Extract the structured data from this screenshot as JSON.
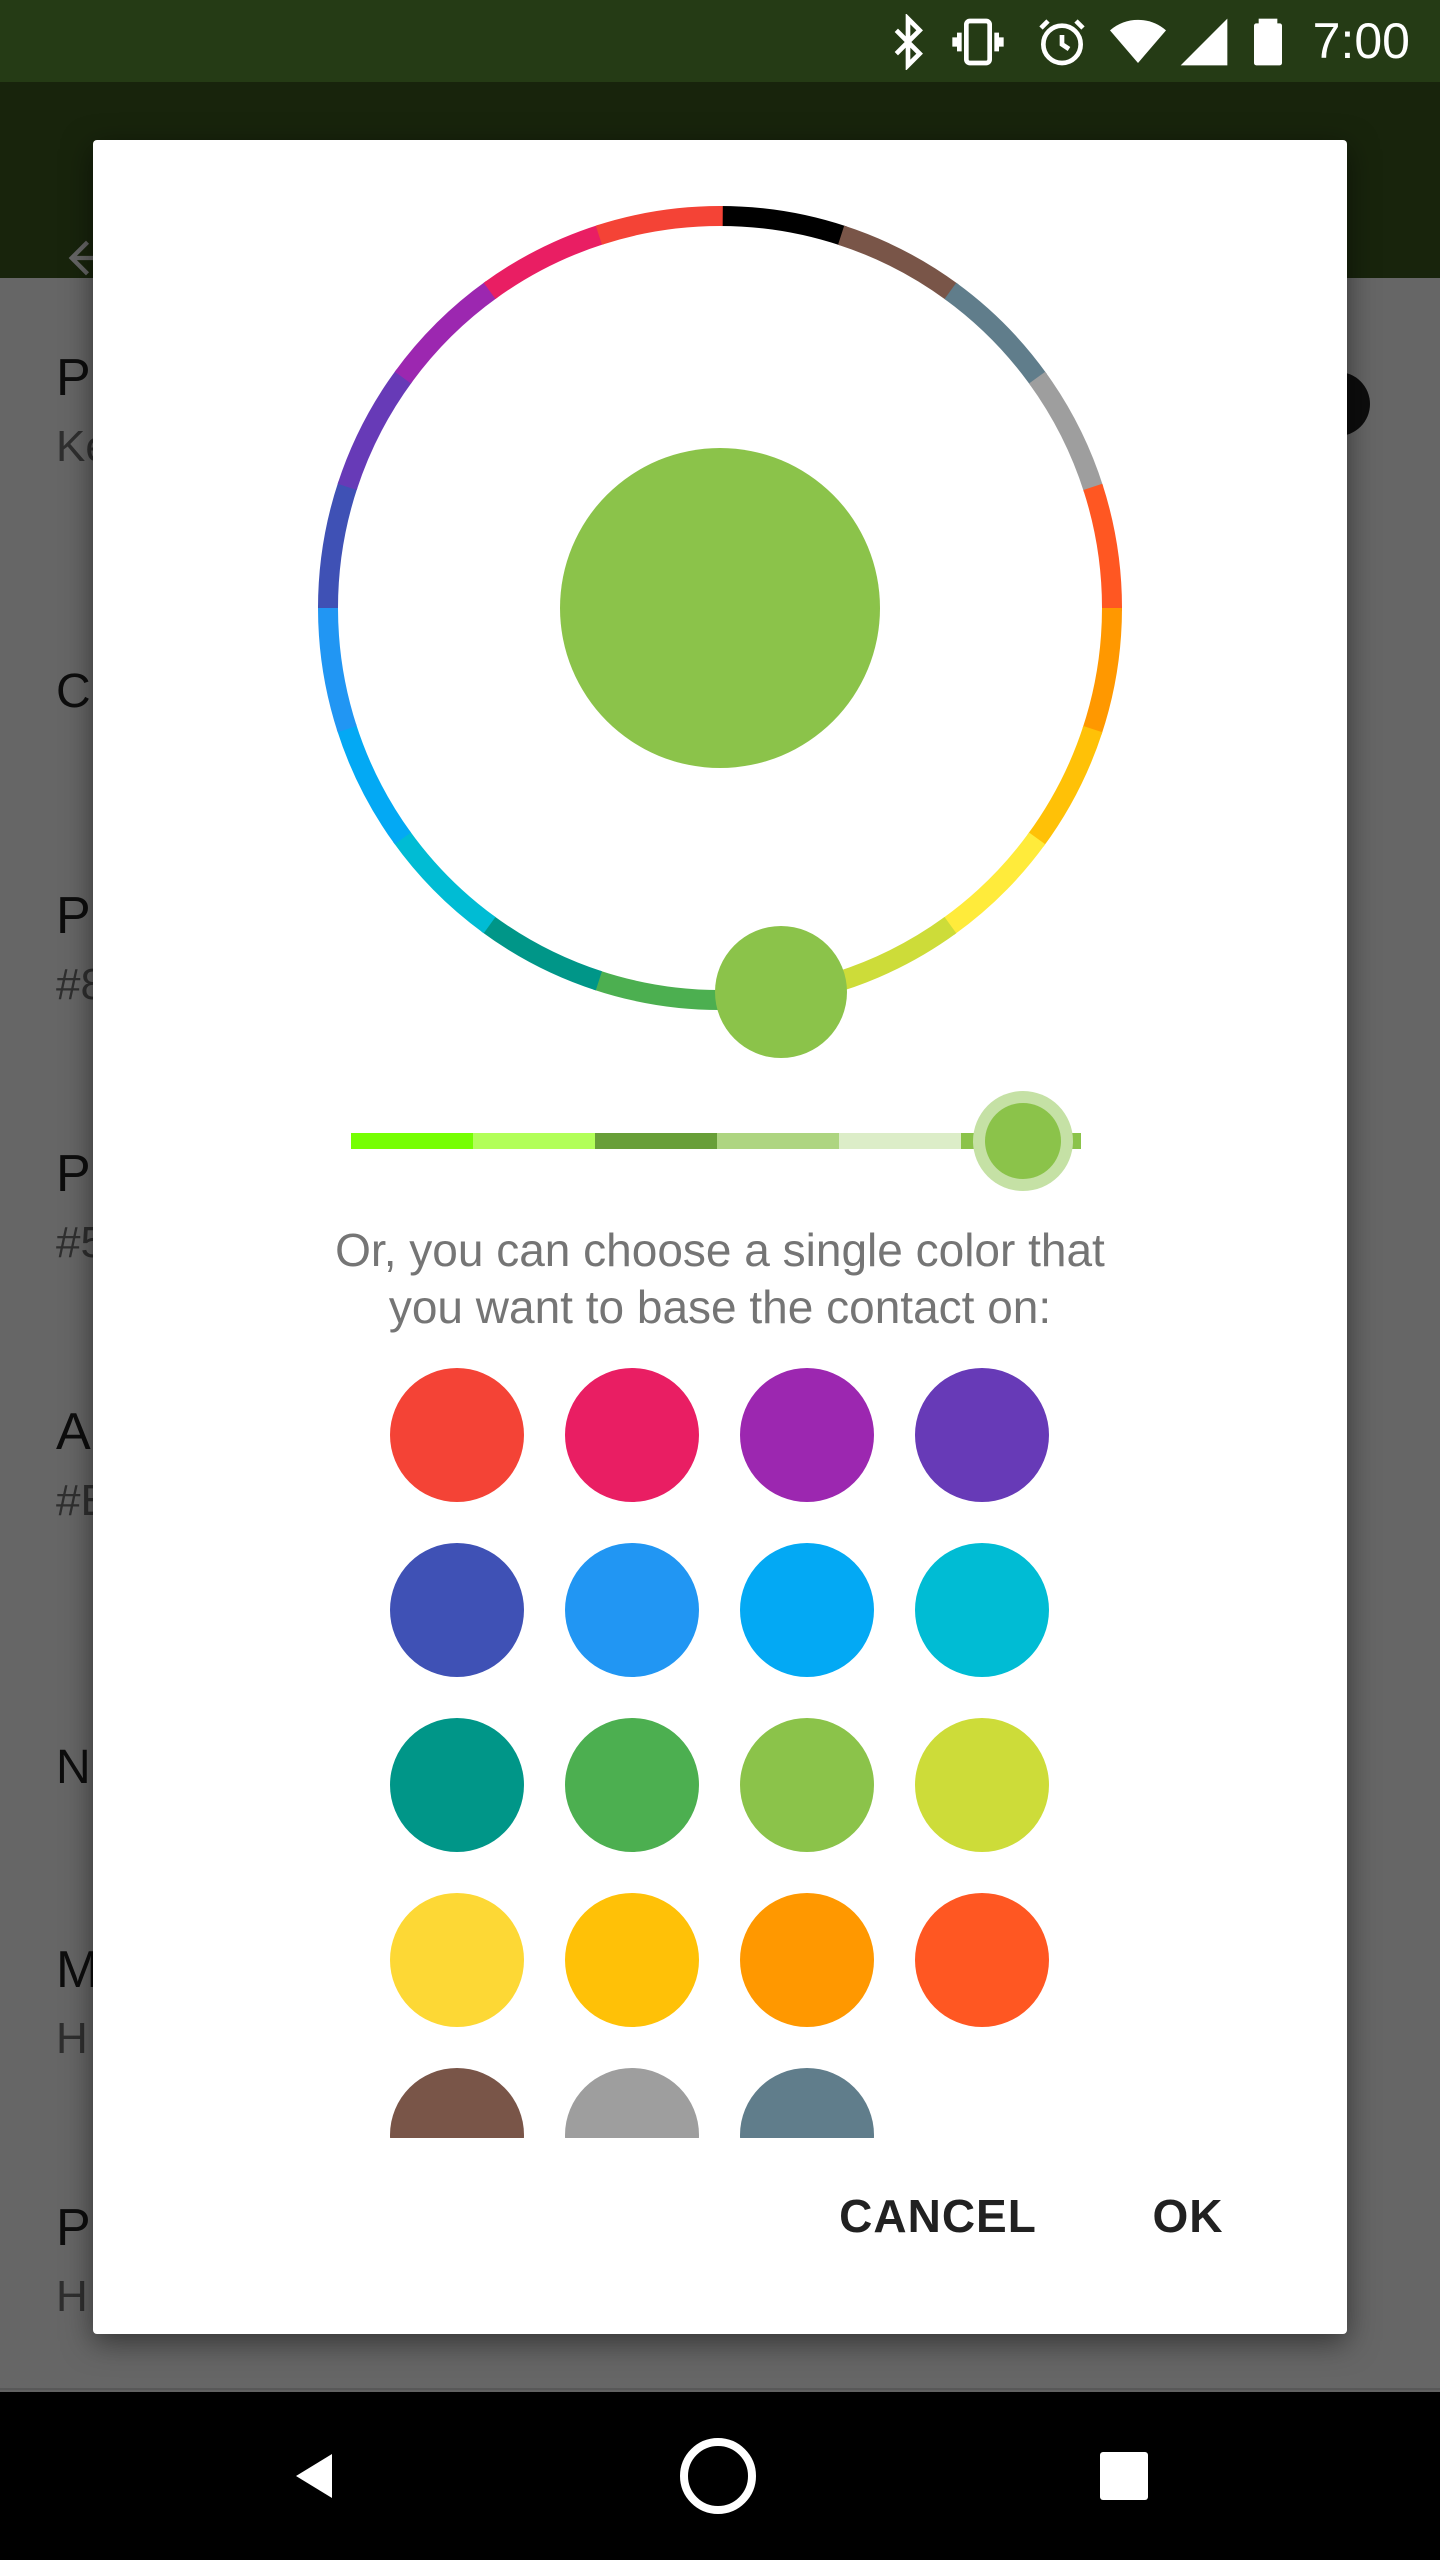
{
  "status_bar": {
    "time": "7:00",
    "icons": [
      "bluetooth-icon",
      "vibrate-icon",
      "alarm-icon",
      "wifi-icon",
      "cell-signal-icon",
      "battery-icon"
    ]
  },
  "background_list": {
    "items": [
      {
        "title": "P",
        "summary": "Ke"
      },
      {
        "header": "C"
      },
      {
        "title": "P",
        "summary": "#8"
      },
      {
        "title": "P",
        "summary": "#5"
      },
      {
        "title": "A",
        "summary": "#E"
      },
      {
        "header": "N"
      },
      {
        "title": "M",
        "summary": "H"
      },
      {
        "title": "P",
        "summary": "H"
      }
    ]
  },
  "dialog": {
    "selected_color": "#8BC34A",
    "wheel_colors": [
      "#000000",
      "#795548",
      "#607D8B",
      "#9E9E9E",
      "#FF5722",
      "#FF9800",
      "#FFC107",
      "#FFEB3B",
      "#CDDC39",
      "#8BC34A",
      "#4CAF50",
      "#009688",
      "#00BCD4",
      "#03A9F4",
      "#2196F3",
      "#3F51B5",
      "#673AB7",
      "#9C27B0",
      "#E91E63",
      "#F44336"
    ],
    "shade_colors": [
      "#76FF03",
      "#B2FF59",
      "#689F38",
      "#AED581",
      "#DCEDC8",
      "#8BC34A"
    ],
    "prompt_line1": "Or, you can choose a single color that",
    "prompt_line2": "you want to base the contact on:",
    "swatches": [
      "#F44336",
      "#E91E63",
      "#9C27B0",
      "#673AB7",
      "#3F51B5",
      "#2196F3",
      "#03A9F4",
      "#00BCD4",
      "#009688",
      "#4CAF50",
      "#8BC34A",
      "#CDDC39",
      "#FDD835",
      "#FFC107",
      "#FF9800",
      "#FF5722",
      "#795548",
      "#9E9E9E",
      "#607D8B"
    ],
    "cancel_label": "CANCEL",
    "ok_label": "OK"
  },
  "nav_bar": {
    "icons": [
      "back-icon",
      "home-icon",
      "recents-icon"
    ]
  }
}
